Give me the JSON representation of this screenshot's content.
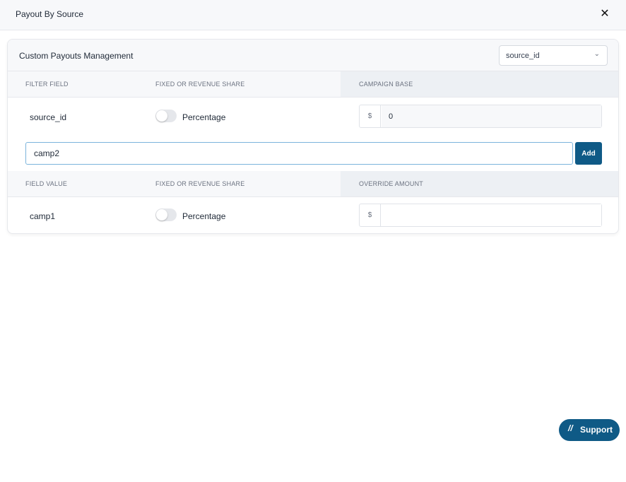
{
  "modal": {
    "title": "Payout By Source",
    "close_icon": "close-icon"
  },
  "card": {
    "title": "Custom Payouts Management",
    "select": {
      "value": "source_id",
      "icon": "chevron-down-icon"
    }
  },
  "filter_table": {
    "headers": [
      "FILTER FIELD",
      "FIXED OR REVENUE SHARE",
      "CAMPAIGN BASE"
    ],
    "row": {
      "field": "source_id",
      "toggle_label": "Percentage",
      "toggle_on": false,
      "currency": "$",
      "amount": "0"
    }
  },
  "add_field": {
    "value": "camp2",
    "button_label": "Add"
  },
  "value_table": {
    "headers": [
      "FIELD VALUE",
      "FIXED OR REVENUE SHARE",
      "OVERRIDE AMOUNT"
    ],
    "row": {
      "field": "camp1",
      "toggle_label": "Percentage",
      "toggle_on": false,
      "currency": "$",
      "amount": ""
    }
  },
  "support": {
    "label": "Support",
    "icon": "slashes-icon",
    "icon_glyph": "//"
  },
  "colors": {
    "primary": "#0f5a86",
    "focus_border": "#7cb4dc",
    "header_bg": "#f7f8fa"
  }
}
